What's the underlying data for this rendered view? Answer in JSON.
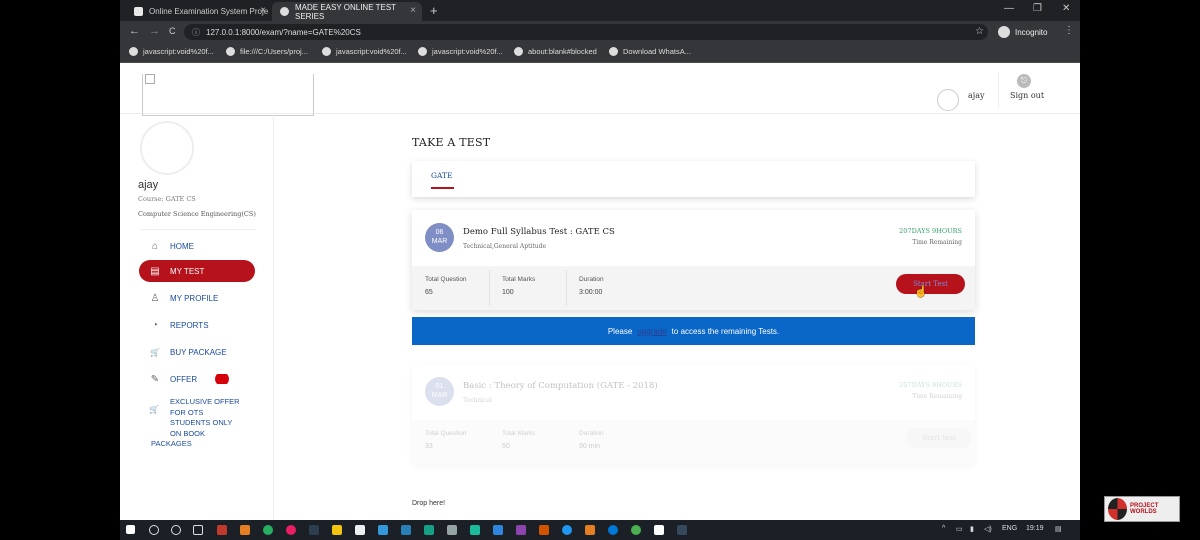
{
  "browser": {
    "tabs": [
      {
        "title": "Online Examination System Proje",
        "close": "×"
      },
      {
        "title": "MADE EASY ONLINE TEST SERIES",
        "close": "×"
      }
    ],
    "new_tab": "+",
    "window_controls": [
      "—",
      "❐",
      "✕"
    ],
    "nav": {
      "back": "←",
      "forward": "→",
      "reload": "C",
      "info": "ⓘ"
    },
    "url": "127.0.0.1:8000/exam/?name=GATE%20CS",
    "star": "☆",
    "profile": "Incognito",
    "menu": "⋮",
    "bookmarks": [
      "javascript:void%20f...",
      "file:///C:/Users/proj...",
      "javascript:void%20f...",
      "javascript:void%20f...",
      "about:blank#blocked",
      "Download WhatsA..."
    ]
  },
  "header": {
    "user": "ajay",
    "signout": "Sign out",
    "signout_icon": "⎋"
  },
  "sidebar": {
    "name": "ajay",
    "course_label": "Course:",
    "course_value": "GATE CS",
    "department": "Computer Science Engineering(CS)",
    "menu": [
      {
        "label": "HOME",
        "icon": "⌂",
        "icon_name": "home-icon"
      },
      {
        "label": "MY TEST",
        "icon": "▤",
        "icon_name": "test-icon"
      },
      {
        "label": "MY PROFILE",
        "icon": "♙",
        "icon_name": "profile-icon"
      },
      {
        "label": "REPORTS",
        "icon": "◔",
        "icon_name": "reports-icon"
      },
      {
        "label": "BUY PACKAGE",
        "icon": "🛒",
        "icon_name": "cart-icon"
      },
      {
        "label": "OFFER",
        "icon": "✎",
        "icon_name": "tag-icon"
      }
    ],
    "exclusive": {
      "line1": "EXCLUSIVE OFFER",
      "line2": "FOR OTS",
      "line3": "STUDENTS ONLY",
      "line4": "ON BOOK",
      "line5": "PACKAGES",
      "icon": "🛒"
    }
  },
  "main": {
    "title": "TAKE A TEST",
    "tab": "GATE",
    "tests": [
      {
        "day": "06",
        "month": "MAR",
        "title": "Demo Full Syllabus Test : GATE CS",
        "subjects": "Technical,General Aptitude",
        "time_left": "207DAYS 9HOURS",
        "time_label": "Time Remaining",
        "question_label": "Total Question",
        "question_value": "65",
        "marks_label": "Total Marks",
        "marks_value": "100",
        "duration_label": "Duration",
        "duration_value": "3:00:00",
        "button": "Start Test"
      },
      {
        "day": "01",
        "month": "MAR",
        "title": "Basic : Theory of Computation (GATE - 2018)",
        "subjects": "Technical",
        "time_left": "207DAYS 9HOURS",
        "time_label": "Time Remaining",
        "question_label": "Total Question",
        "question_value": "33",
        "marks_label": "Total Marks",
        "marks_value": "50",
        "duration_label": "Duration",
        "duration_value": "90 min",
        "button": "Start test"
      }
    ],
    "banner": {
      "before": "Please",
      "link": "upgrade",
      "after": "to access the remaining Tests."
    },
    "drop": "Drop here!"
  },
  "taskbar": {
    "lang": "ENG",
    "time": "19:19"
  },
  "watermark": "PROJECT WORLDS"
}
